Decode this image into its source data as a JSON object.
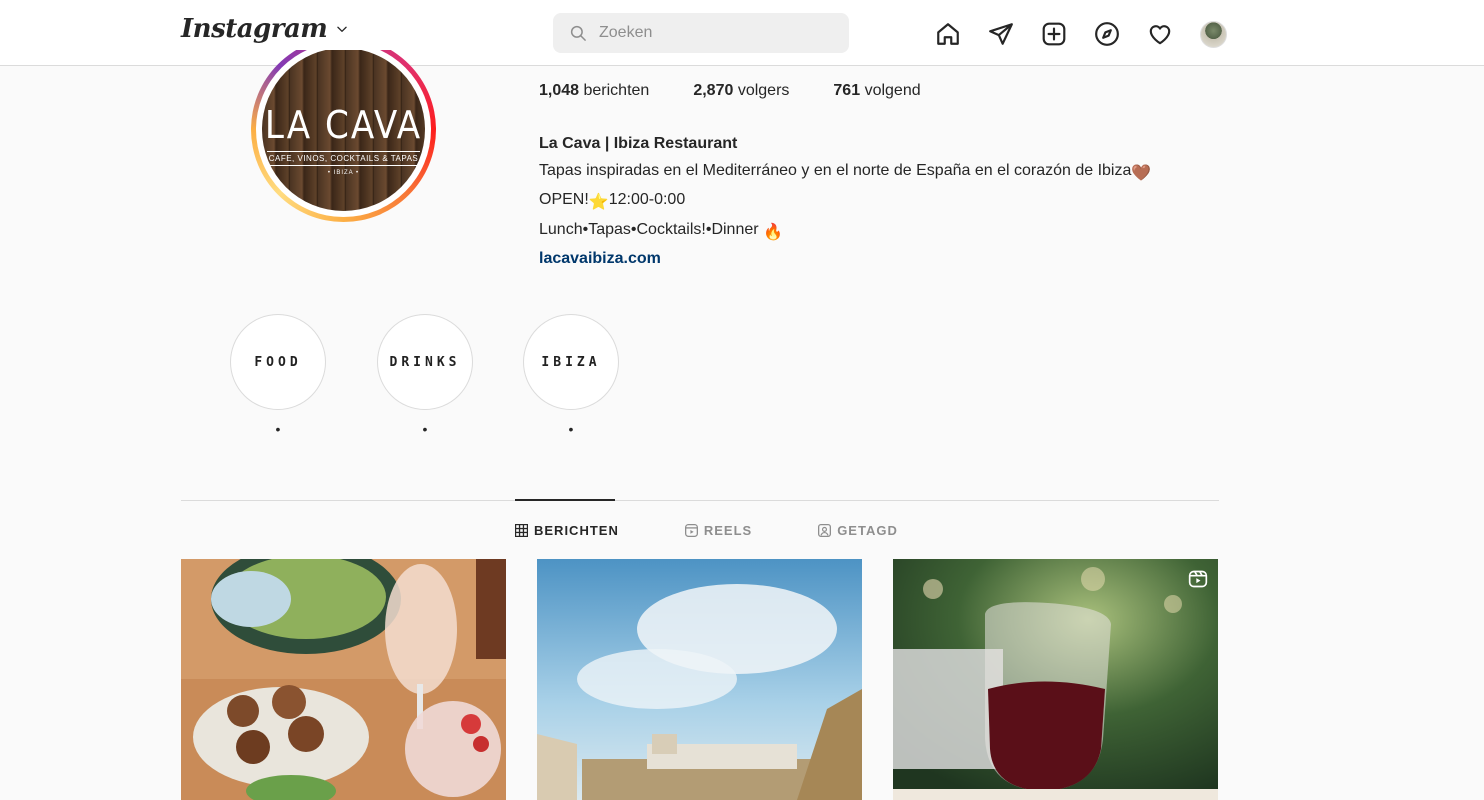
{
  "header": {
    "logo": "Instagram",
    "search_placeholder": "Zoeken"
  },
  "profile": {
    "avatar": {
      "title": "LA CAVA",
      "subtitle": "CAFE, VINOS, COCKTAILS & TAPAS",
      "small": "• IBIZA •"
    },
    "stats": [
      {
        "value": "1,048",
        "label": "berichten"
      },
      {
        "value": "2,870",
        "label": "volgers"
      },
      {
        "value": "761",
        "label": "volgend"
      }
    ],
    "name": "La Cava | Ibiza Restaurant",
    "bio_line1": "Tapas inspiradas en el Mediterráneo y en el norte de España en el corazón de Ibiza",
    "bio_line1_emoji": "🤎",
    "bio_line2_prefix": "OPEN!",
    "bio_line2_emoji": "⭐",
    "bio_line2_suffix": "12:00-0:00",
    "bio_line3": "Lunch•Tapas•Cocktails!•Dinner",
    "bio_line3_emoji": "🔥",
    "website": "lacavaibiza.com"
  },
  "highlights": [
    {
      "cover_text": "FOOD",
      "label": "•"
    },
    {
      "cover_text": "DRINKS",
      "label": "•"
    },
    {
      "cover_text": "IBIZA",
      "label": "•"
    }
  ],
  "tabs": [
    {
      "label": "BERICHTEN",
      "active": true,
      "icon": "grid-icon"
    },
    {
      "label": "REELS",
      "active": false,
      "icon": "reels-icon"
    },
    {
      "label": "GETAGD",
      "active": false,
      "icon": "tagged-icon"
    }
  ],
  "colors": {
    "link": "#00376b",
    "border": "#dbdbdb",
    "muted": "#8e8e8e",
    "text": "#262626"
  }
}
